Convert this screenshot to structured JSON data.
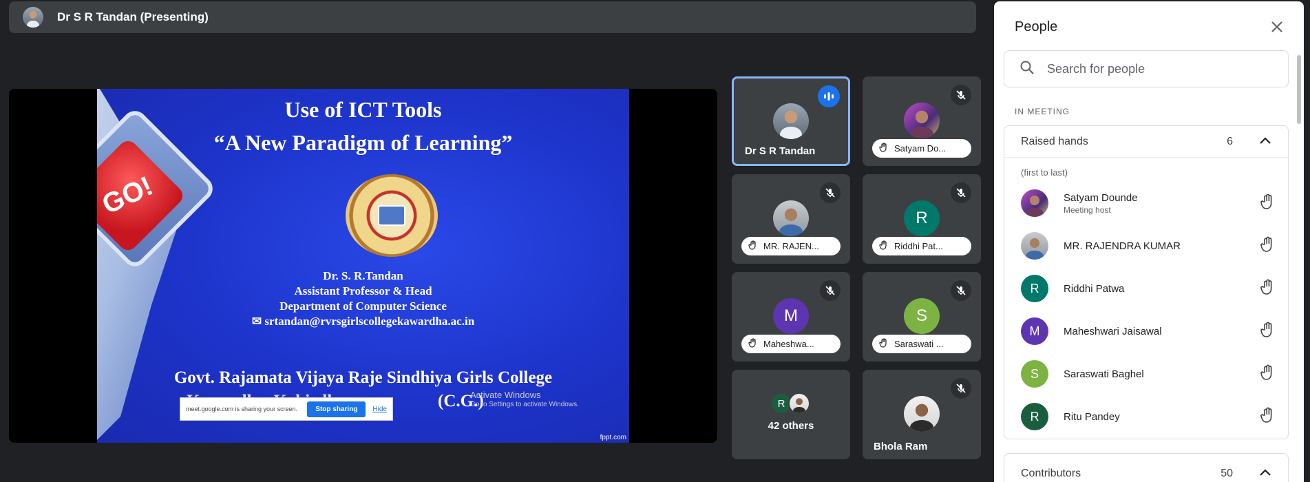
{
  "topbar": {
    "presenter_title": "Dr S R Tandan (Presenting)"
  },
  "slide": {
    "title_line1": "Use of ICT Tools",
    "title_line2": "“A New Paradigm of Learning”",
    "go_text": "GO!",
    "author": "Dr. S. R.Tandan",
    "position": "Assistant Professor & Head",
    "department": "Department of Computer Science",
    "email": "srtandan@rvrsgirlscollegekawardha.ac.in",
    "college": "Govt. Rajamata Vijaya Raje Sindhiya Girls College",
    "location_partial": "Kawardha, Kabirdham",
    "state": "(C.G.)",
    "footer": "fppt.com"
  },
  "sharing_bar": {
    "text": "meet.google.com is sharing your screen.",
    "stop_label": "Stop sharing",
    "hide_label": "Hide"
  },
  "watermark": {
    "line1": "Activate Windows",
    "line2": "Go to Settings to activate Windows."
  },
  "tiles": [
    {
      "name": "Dr S R Tandan"
    },
    {
      "name": "Satyam Do..."
    },
    {
      "name": "MR. RAJEN..."
    },
    {
      "name": "Riddhi Pat...",
      "letter": "R"
    },
    {
      "name": "Maheshwa...",
      "letter": "M"
    },
    {
      "name": "Saraswati ...",
      "letter": "S"
    },
    {
      "name": "42 others",
      "letter": "R"
    },
    {
      "name": "Bhola Ram"
    }
  ],
  "panel": {
    "title": "People",
    "search_placeholder": "Search for people",
    "section": "IN MEETING",
    "raised_hands": {
      "label": "Raised hands",
      "count": "6",
      "hint": "(first to last)"
    },
    "people": [
      {
        "name": "Satyam Dounde",
        "sub": "Meeting host"
      },
      {
        "name": "MR. RAJENDRA KUMAR"
      },
      {
        "name": "Riddhi Patwa",
        "letter": "R"
      },
      {
        "name": "Maheshwari Jaisawal",
        "letter": "M"
      },
      {
        "name": "Saraswati Baghel",
        "letter": "S"
      },
      {
        "name": "Ritu Pandey",
        "letter": "R"
      }
    ],
    "contributors": {
      "label": "Contributors",
      "count": "50"
    }
  },
  "colors": {
    "teal": "#00796b",
    "purple": "#5e35b1",
    "green": "#7cb342",
    "dark_green": "#1b5e3f",
    "accent": "#1a73e8"
  }
}
